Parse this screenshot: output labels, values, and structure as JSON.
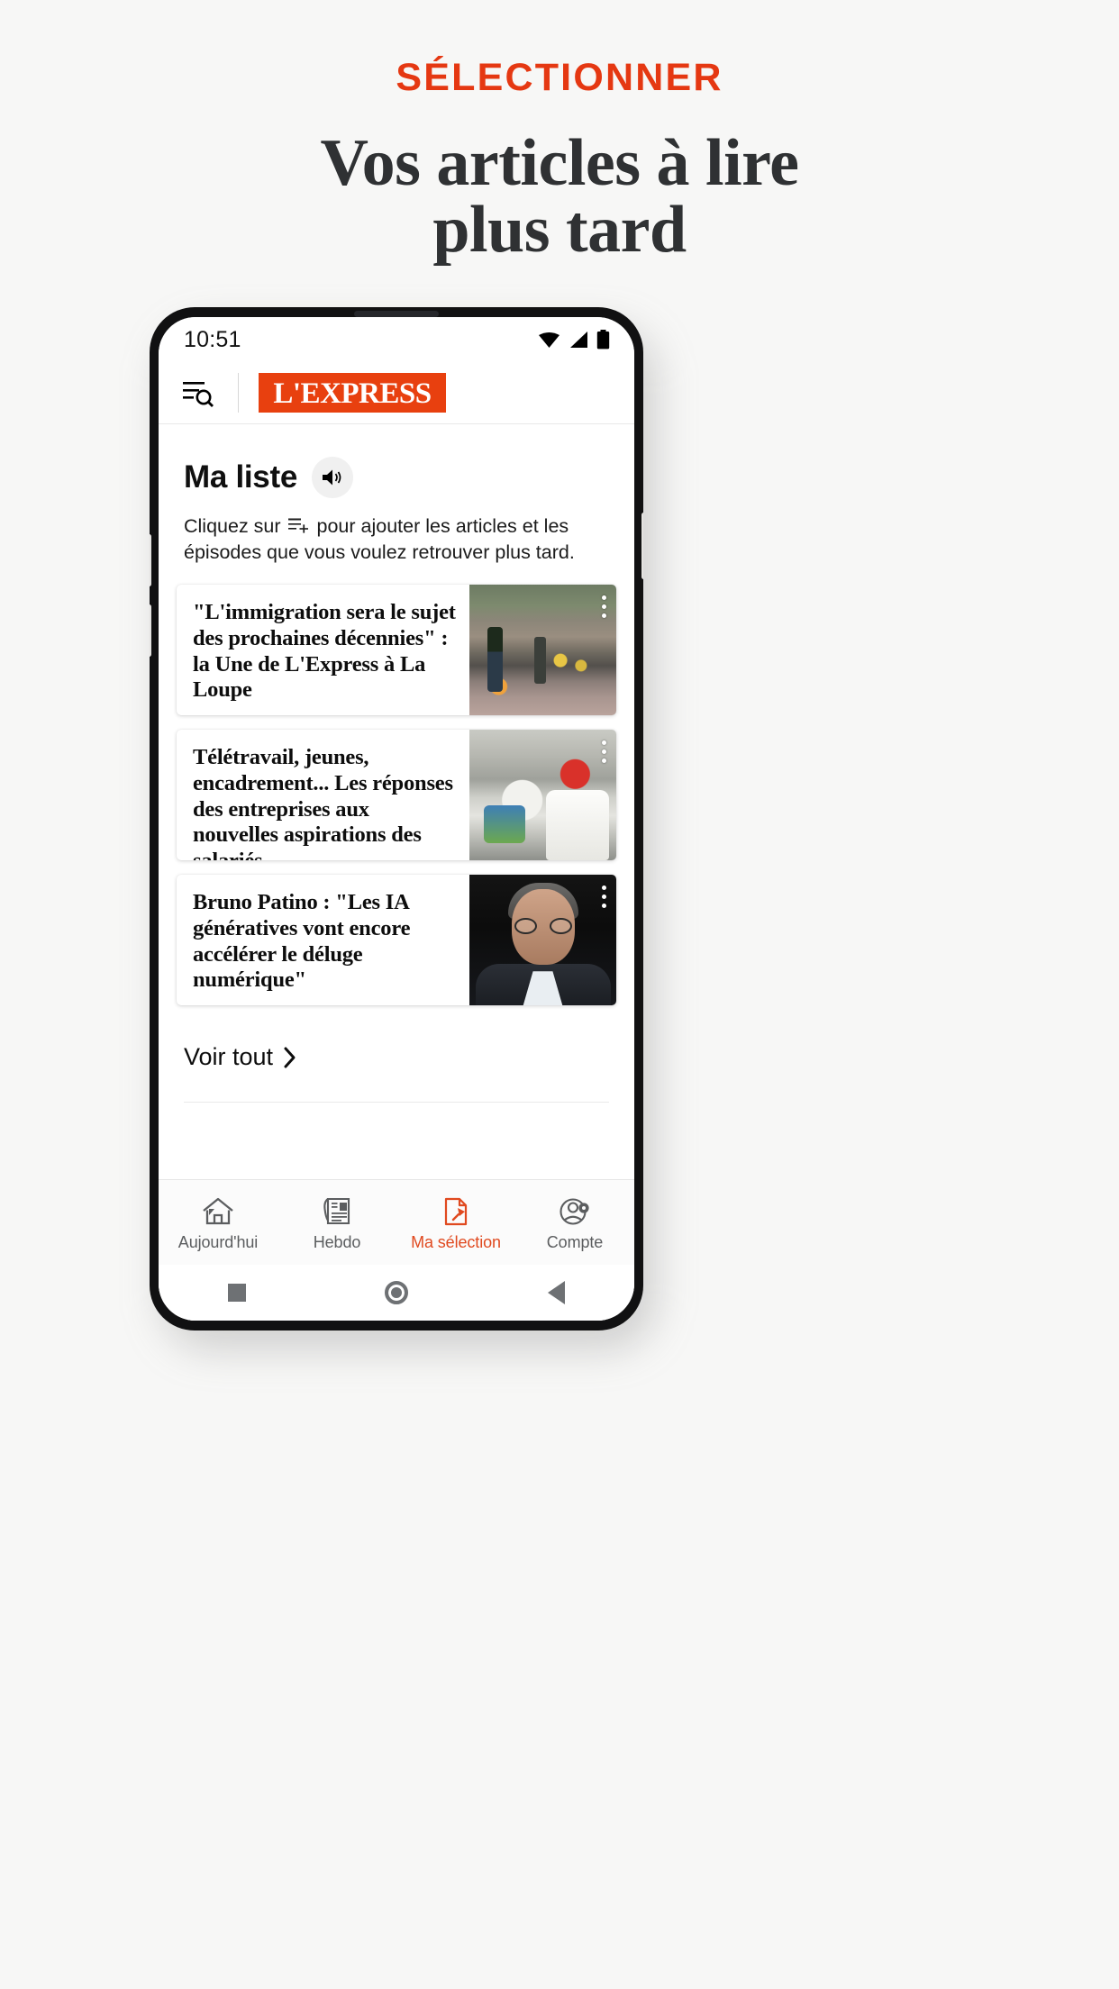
{
  "promo": {
    "kicker": "SÉLECTIONNER",
    "title_line1": "Vos articles à lire",
    "title_line2": "plus tard",
    "accent_color": "#e53812",
    "title_color": "#2f3133",
    "background_color": "#f7f7f6"
  },
  "phone": {
    "status_bar": {
      "time": "10:51",
      "icons": [
        "wifi-icon",
        "cellular-signal-icon",
        "battery-icon"
      ]
    },
    "app_header": {
      "menu_icon": "menu-search-icon",
      "logo_text": "L'EXPRESS",
      "logo_background": "#e8400f"
    },
    "section": {
      "title": "Ma liste",
      "audio_icon": "speaker-icon",
      "description_before": "Cliquez sur",
      "description_icon": "add-to-list-icon",
      "description_after": "pour ajouter les articles et les épisodes que vous voulez retrouver plus tard."
    },
    "articles": [
      {
        "title": "\"L'immigration sera le sujet des prochaines décennies\" : la Une de L'Express à La Loupe",
        "image": "street-scene-photo",
        "menu_icon": "kebab-menu-icon"
      },
      {
        "title": "Télétravail, jeunes, encadrement... Les réponses des entreprises aux nouvelles aspirations des salariés",
        "image": "chef-kitchen-photo",
        "menu_icon": "kebab-menu-icon"
      },
      {
        "title": "Bruno Patino : \"Les IA génératives vont encore accélérer le déluge numérique\"",
        "image": "portrait-bruno-patino-photo",
        "menu_icon": "kebab-menu-icon"
      }
    ],
    "see_all": {
      "label": "Voir tout",
      "icon": "chevron-right-icon"
    },
    "tabs": [
      {
        "label": "Aujourd'hui",
        "icon": "home-icon",
        "active": false
      },
      {
        "label": "Hebdo",
        "icon": "newspaper-icon",
        "active": false
      },
      {
        "label": "Ma sélection",
        "icon": "pinned-document-icon",
        "active": true
      },
      {
        "label": "Compte",
        "icon": "account-settings-icon",
        "active": false
      }
    ],
    "tab_active_color": "#e0491f",
    "tab_inactive_color": "#5b5d5f",
    "android_nav": [
      "recents-square-icon",
      "home-circle-icon",
      "back-triangle-icon"
    ]
  }
}
